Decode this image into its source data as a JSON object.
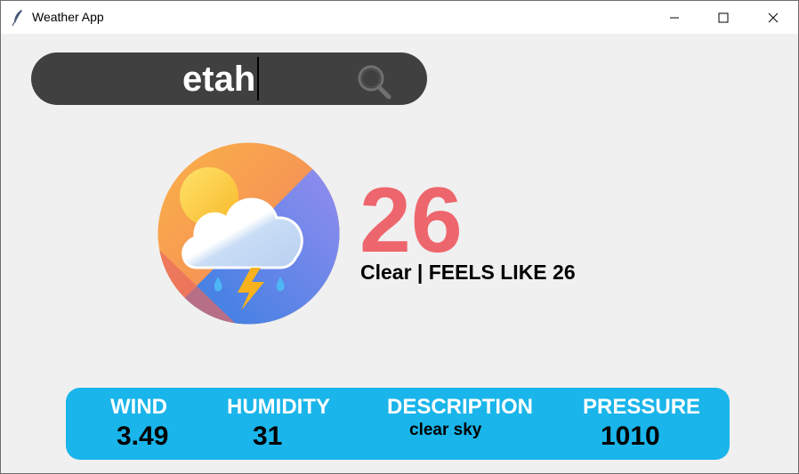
{
  "window": {
    "title": "Weather App",
    "icon": "feather-icon"
  },
  "search": {
    "value": "etah",
    "icon": "search-icon"
  },
  "weather": {
    "icon": "sun-cloud-storm-icon",
    "temperature": "26",
    "condition": "Clear | FEELS LIKE 26"
  },
  "info": {
    "wind_label": "WIND",
    "wind_value": "3.49",
    "humidity_label": "HUMIDITY",
    "humidity_value": "31",
    "description_label": "DESCRIPTION",
    "description_value": "clear sky",
    "pressure_label": "PRESSURE",
    "pressure_value": "1010"
  },
  "colors": {
    "background": "#f0f0f0",
    "search_bar": "#404040",
    "temperature": "#ee666d",
    "info_bar": "#1ab5ea",
    "info_label": "#ffffff"
  }
}
